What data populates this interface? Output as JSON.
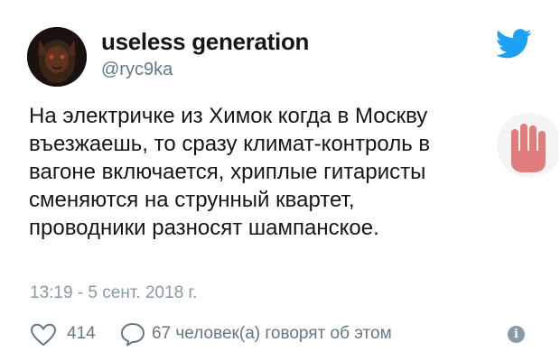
{
  "user": {
    "display_name": "useless generation",
    "handle": "@ryc9ka"
  },
  "tweet": {
    "lines": [
      "На электричке из Химок когда в Москву",
      "въезжаешь, то сразу климат-контроль в",
      "вагоне включается, хриплые гитаристы",
      "сменяются на струнный квартет,",
      "проводники разносят шампанское."
    ],
    "timestamp": "13:19 - 5 сент. 2018 г."
  },
  "engagement": {
    "likes": "414",
    "talking": "67 человек(а) говорят об этом"
  },
  "icons": {
    "brand": "twitter-bird-icon",
    "like": "heart-icon",
    "reply": "speech-bubble-icon",
    "info": "info-icon",
    "watermark": "raised-hand-icon"
  },
  "colors": {
    "twitter_blue": "#1da1f2",
    "text": "#14171a",
    "secondary": "#657786",
    "watermark": "#e07070"
  }
}
